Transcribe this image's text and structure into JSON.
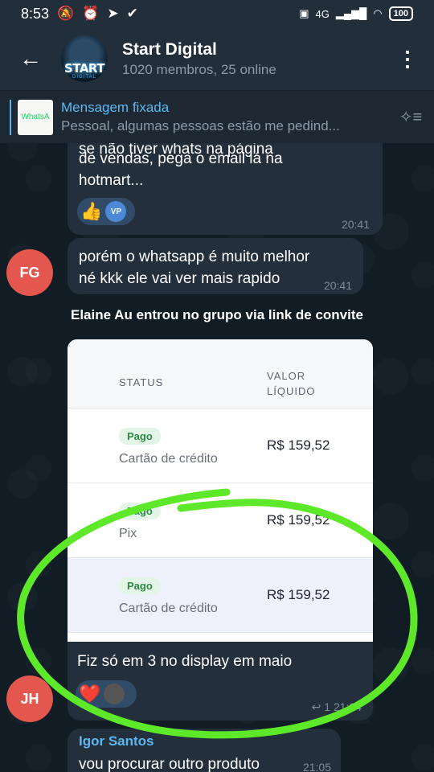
{
  "status_bar": {
    "time": "8:53",
    "network": "4G",
    "battery": "100"
  },
  "header": {
    "title": "Start Digital",
    "subtitle": "1020 membros, 25 online",
    "avatar_text": "START",
    "avatar_sub": "DIGITAL"
  },
  "pinned": {
    "title": "Mensagem fixada",
    "body": "Pessoal, algumas pessoas estão me pedind...",
    "thumb_label": "WhatsA"
  },
  "messages": {
    "m1": {
      "lines": [
        "de vendas, pega o email lá na",
        "hotmart..."
      ],
      "partial_top": "se não tiver whats na página",
      "time": "20:41",
      "reaction_emoji": "👍",
      "reaction_user": "VP"
    },
    "m2": {
      "avatar": "FG",
      "lines": [
        "porém o whatsapp é muito melhor",
        "né kkk ele vai ver mais rapido"
      ],
      "time": "20:41"
    },
    "service": "Elaine Au entrou no grupo via link de convite",
    "m3": {
      "avatar": "JH",
      "table": {
        "col_status": "STATUS",
        "col_valor_1": "VALOR",
        "col_valor_2": "LÍQUIDO",
        "rows": [
          {
            "badge": "Pago",
            "method": "Cartão de crédito",
            "amount": "R$ 159,52"
          },
          {
            "badge": "Pago",
            "method": "Pix",
            "amount": "R$ 159,52"
          },
          {
            "badge": "Pago",
            "method": "Cartão de crédito",
            "amount": "R$ 159,52"
          }
        ]
      },
      "caption": "Fiz só em 3 no display em maio",
      "reaction_emoji": "❤️",
      "meta": "↩ 1 21:04"
    },
    "m4": {
      "name": "Igor Santos",
      "text": "vou procurar outro produto",
      "time": "21:05"
    }
  },
  "colors": {
    "accent": "#5db8f2",
    "highlight": "#5ee82a",
    "avatar_red": "#e4574f"
  }
}
